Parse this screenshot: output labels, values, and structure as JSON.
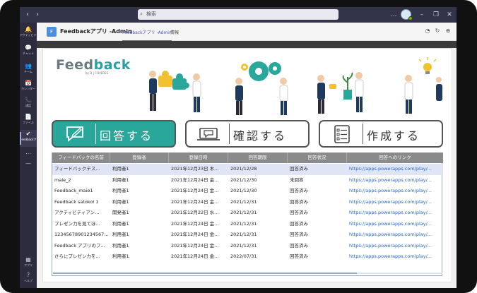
{
  "titlebar": {
    "back_icon": "chevron-left-icon",
    "forward_icon": "chevron-right-icon",
    "search_placeholder": "検索",
    "more_label": "…",
    "min_label": "–",
    "max_label": "❐",
    "close_label": "✕"
  },
  "rail": {
    "items": [
      {
        "icon": "🔔",
        "label": "アクティビティ"
      },
      {
        "icon": "💬",
        "label": "チャット"
      },
      {
        "icon": "👥",
        "label": "チーム"
      },
      {
        "icon": "📅",
        "label": "カレンダー"
      },
      {
        "icon": "📞",
        "label": "通話"
      },
      {
        "icon": "📄",
        "label": "ファイル"
      },
      {
        "icon": "✔",
        "label": "Feedbackア"
      },
      {
        "icon": "…",
        "label": ""
      },
      {
        "icon": "—",
        "label": ""
      }
    ],
    "apps_icon": "▦",
    "apps_label": "アプリ",
    "help_icon": "?",
    "help_label": "ヘルプ"
  },
  "apphead": {
    "logo_glyph": "F",
    "app_name": "Feedbackアプリ -Admin",
    "tabs": [
      {
        "label": "Feedbackアプリ -Admin",
        "active": true
      },
      {
        "label": "情報",
        "active": false
      }
    ],
    "icons": [
      "chat-icon",
      "refresh-icon",
      "globe-icon"
    ]
  },
  "canvas": {
    "logo_main": "Feed",
    "logo_accent": "back",
    "logo_sub": "by  D | COVERES",
    "buttons": [
      {
        "label": "回答する",
        "icon": "pen-chat-icon",
        "primary": true
      },
      {
        "label": "確認する",
        "icon": "laptop-chat-icon",
        "primary": false
      },
      {
        "label": "作成する",
        "icon": "checklist-icon",
        "primary": false
      }
    ]
  },
  "table": {
    "headers": [
      "フィードバックの名前",
      "登録者",
      "登録日時",
      "回答期限",
      "回答状況",
      "回答へのリンク"
    ],
    "rows": [
      [
        "フィードバックテス...",
        "利用者1",
        "2021年12月23日 木...",
        "2021/12/28",
        "回答済み",
        "https://apps.powerapps.com/play/..."
      ],
      [
        "maie_2",
        "利用者1",
        "2021年12月24日 金...",
        "2021/12/30",
        "未回答",
        "https://apps.powerapps.com/play/..."
      ],
      [
        "Feedback_maie1",
        "利用者1",
        "2021年12月24日 金...",
        "2021/12/30",
        "回答済み",
        "https://apps.powerapps.com/play/..."
      ],
      [
        "Feedback satokoi 1",
        "利用者1",
        "2021年12月24日 金...",
        "2021/12/31",
        "回答済み",
        "https://apps.powerapps.com/play/..."
      ],
      [
        "アクティビティアン...",
        "開発者1",
        "2021年12月22日 水...",
        "2021/12/31",
        "回答済み",
        "https://apps.powerapps.com/play/..."
      ],
      [
        "プレゼン力を見てほ...",
        "利用者1",
        "2021年12月24日 金...",
        "2021/12/31",
        "回答済み",
        "https://apps.powerapps.com/play/..."
      ],
      [
        "12345678901234567...",
        "利用者1",
        "2021年12月24日 金...",
        "2021/12/31",
        "回答済み",
        "https://apps.powerapps.com/play/..."
      ],
      [
        "Feedback アプリのフ...",
        "利用者1",
        "2021年12月24日 金...",
        "2021/12/31",
        "回答済み",
        "https://apps.powerapps.com/play/..."
      ],
      [
        "さらにプレゼン力を...",
        "利用者1",
        "2021年12月24日 金...",
        "2022/07/31",
        "回答済み",
        "https://apps.powerapps.com/play/..."
      ]
    ]
  },
  "colors": {
    "accent_teal": "#2aa79b",
    "rail_bg": "#2d2c3f",
    "titlebar_bg": "#33344a",
    "link": "#2266cc"
  }
}
